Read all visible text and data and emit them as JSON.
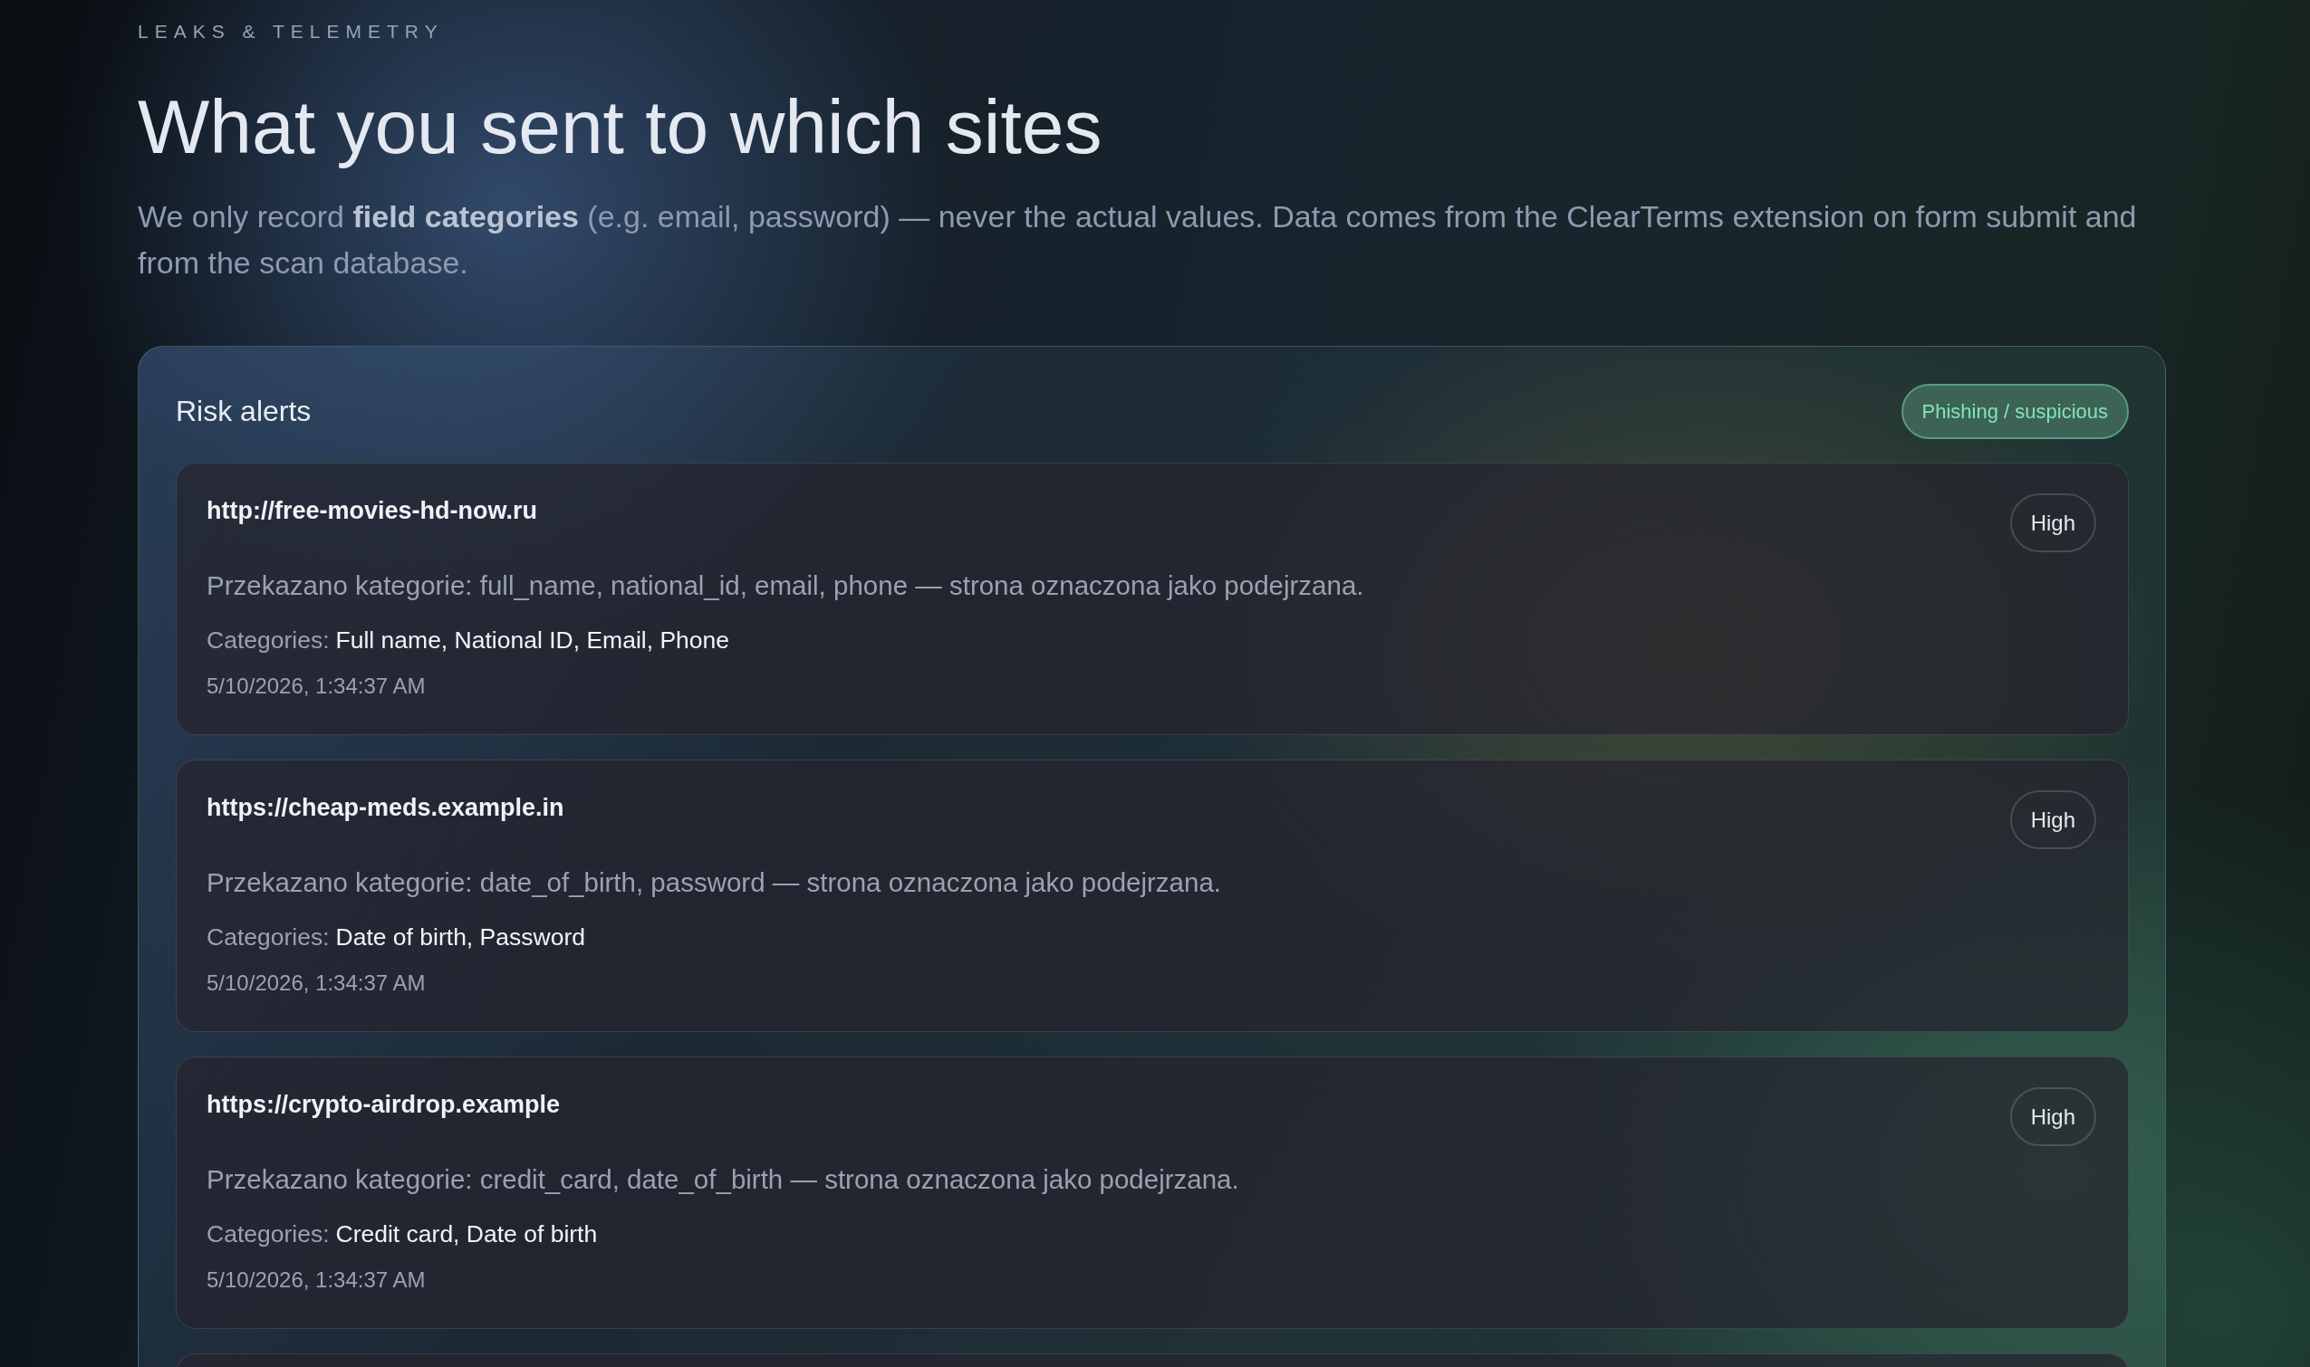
{
  "header": {
    "eyebrow": "LEAKS & TELEMETRY",
    "title": "What you sent to which sites",
    "intro": "We only record **field categories** (e.g. email, password) — never the actual values. Data comes from the ClearTerms extension on form submit and from the scan database."
  },
  "risk_alerts": {
    "title": "Risk alerts",
    "tag": "Phishing / suspicious",
    "alerts": [
      {
        "url": "http://free-movies-hd-now.ru",
        "severity": "High",
        "description": "Przekazano kategorie: full_name, national_id, email, phone — strona oznaczona jako podejrzana.",
        "categories_label": "Categories:",
        "categories": "Full name, National ID, Email, Phone",
        "timestamp": "5/10/2026, 1:34:37 AM"
      },
      {
        "url": "https://cheap-meds.example.in",
        "severity": "High",
        "description": "Przekazano kategorie: date_of_birth, password — strona oznaczona jako podejrzana.",
        "categories_label": "Categories:",
        "categories": "Date of birth, Password",
        "timestamp": "5/10/2026, 1:34:37 AM"
      },
      {
        "url": "https://crypto-airdrop.example",
        "severity": "High",
        "description": "Przekazano kategorie: credit_card, date_of_birth — strona oznaczona jako podejrzana.",
        "categories_label": "Categories:",
        "categories": "Credit card, Date of birth",
        "timestamp": "5/10/2026, 1:34:37 AM"
      }
    ]
  }
}
